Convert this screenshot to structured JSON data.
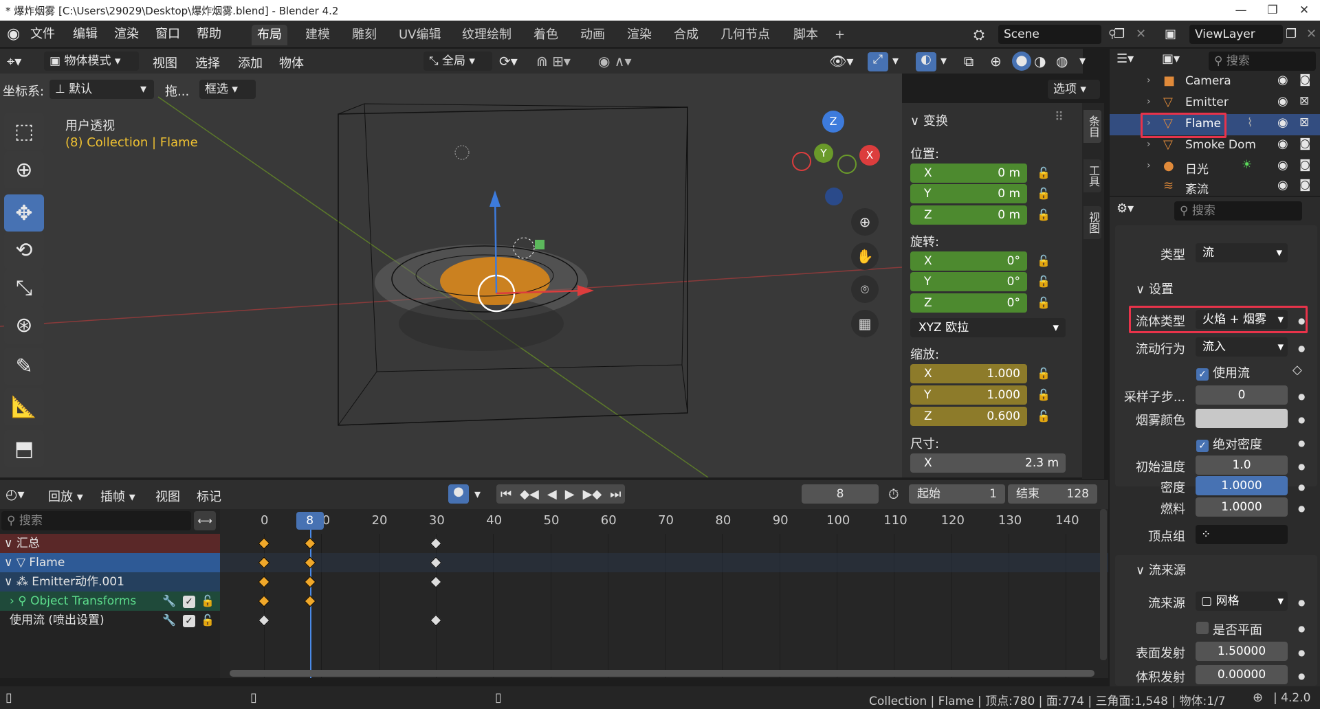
{
  "titlebar": {
    "text": "* 爆炸烟雾 [C:\\Users\\29029\\Desktop\\爆炸烟雾.blend] - Blender 4.2",
    "min": "—",
    "max": "❐",
    "close": "✕"
  },
  "menu": [
    "文件",
    "编辑",
    "渲染",
    "窗口",
    "帮助"
  ],
  "workspaces": [
    "布局",
    "建模",
    "雕刻",
    "UV编辑",
    "纹理绘制",
    "着色",
    "动画",
    "渲染",
    "合成",
    "几何节点",
    "脚本",
    "+"
  ],
  "scene": "Scene",
  "viewlayer": "ViewLayer",
  "viewport_header": {
    "mode": "物体模式",
    "menus": [
      "视图",
      "选择",
      "添加",
      "物体"
    ],
    "transform": "全局",
    "coord_label": "坐标系:",
    "coord_value": "默认",
    "drag_label": "拖...",
    "select_mode": "框选",
    "options": "选项"
  },
  "viewport": {
    "view_name": "用户透视",
    "collection_info": "(8) Collection | Flame",
    "gizmo": {
      "x": "X",
      "y": "Y",
      "z": "Z"
    }
  },
  "npanel": {
    "header": "变换",
    "location_label": "位置:",
    "location": [
      {
        "ax": "X",
        "v": "0 m"
      },
      {
        "ax": "Y",
        "v": "0 m"
      },
      {
        "ax": "Z",
        "v": "0 m"
      }
    ],
    "rotation_label": "旋转:",
    "rotation": [
      {
        "ax": "X",
        "v": "0°"
      },
      {
        "ax": "Y",
        "v": "0°"
      },
      {
        "ax": "Z",
        "v": "0°"
      }
    ],
    "rotation_mode": "XYZ 欧拉",
    "scale_label": "缩放:",
    "scale": [
      {
        "ax": "X",
        "v": "1.000"
      },
      {
        "ax": "Y",
        "v": "1.000"
      },
      {
        "ax": "Z",
        "v": "0.600"
      }
    ],
    "dimensions_label": "尺寸:",
    "dimensions": [
      {
        "ax": "X",
        "v": "2.3 m"
      }
    ],
    "tabs": [
      "条目",
      "工具",
      "视图"
    ]
  },
  "outliner": {
    "search_placeholder": "搜索",
    "items": [
      {
        "name": "Camera",
        "icon": "camera-icon"
      },
      {
        "name": "Emitter",
        "icon": "mesh-icon"
      },
      {
        "name": "Flame",
        "icon": "mesh-icon"
      },
      {
        "name": "Smoke Dom",
        "icon": "mesh-icon"
      },
      {
        "name": "日光",
        "icon": "light-icon"
      },
      {
        "name": "紊流",
        "icon": "force-icon"
      }
    ]
  },
  "properties": {
    "search_placeholder": "搜索",
    "type_label": "类型",
    "type_value": "流",
    "settings_header": "设置",
    "fluid_type_label": "流体类型",
    "fluid_type_value": "火焰 + 烟雾",
    "flow_behavior_label": "流动行为",
    "flow_behavior_value": "流入",
    "use_flow": "使用流",
    "subframes_label": "采样子步...",
    "subframes_value": "0",
    "smoke_color_label": "烟雾颜色",
    "absolute_density": "绝对密度",
    "init_temp_label": "初始温度",
    "init_temp_value": "1.0",
    "density_label": "密度",
    "density_value": "1.0000",
    "fuel_label": "燃料",
    "fuel_value": "1.0000",
    "vertex_group_label": "顶点组",
    "flow_source_header": "流来源",
    "flow_source_label": "流来源",
    "flow_source_value": "网格",
    "is_planar": "是否平面",
    "surface_emission_label": "表面发射",
    "surface_emission_value": "1.50000",
    "volume_emission_label": "体积发射",
    "volume_emission_value": "0.00000"
  },
  "timeline": {
    "menus": [
      "回放",
      "插帧",
      "视图",
      "标记"
    ],
    "current_frame": "8",
    "start_label": "起始",
    "start_value": "1",
    "end_label": "结束",
    "end_value": "128",
    "search_placeholder": "搜索",
    "ticks": [
      "0",
      "10",
      "20",
      "30",
      "40",
      "50",
      "60",
      "70",
      "80",
      "90",
      "100",
      "110",
      "120",
      "130",
      "140"
    ],
    "channels": [
      {
        "name": "汇总",
        "kind": "summary"
      },
      {
        "name": "Flame",
        "kind": "object"
      },
      {
        "name": "Emitter动作.001",
        "kind": "action"
      },
      {
        "name": "Object Transforms",
        "kind": "group"
      },
      {
        "name": "使用流 (喷出设置)",
        "kind": "fcurve"
      }
    ]
  },
  "statusbar": {
    "text": "Collection | Flame | 顶点:780 | 面:774 | 三角面:1,548 | 物体:1/7",
    "version": "4.2.0"
  },
  "colors": {
    "accent": "#4772b3",
    "highlight": "#e8334a",
    "keyframe": "#f0a82a",
    "green_field": "#4d8a2f",
    "yellow_field": "#8d7b2a"
  }
}
